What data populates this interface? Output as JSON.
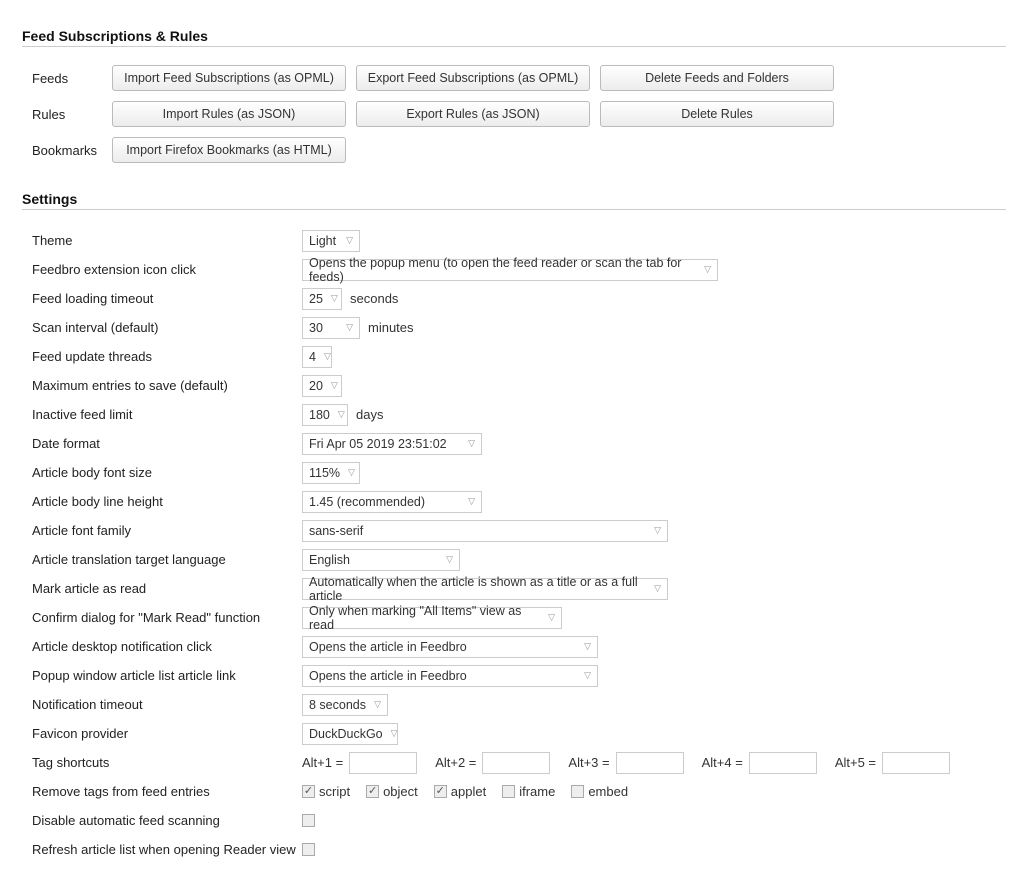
{
  "sections": {
    "subs_title": "Feed Subscriptions & Rules",
    "settings_title": "Settings"
  },
  "subs": {
    "feeds": {
      "label": "Feeds",
      "import": "Import Feed Subscriptions (as OPML)",
      "export": "Export Feed Subscriptions (as OPML)",
      "delete": "Delete Feeds and Folders"
    },
    "rules": {
      "label": "Rules",
      "import": "Import Rules (as JSON)",
      "export": "Export Rules (as JSON)",
      "delete": "Delete Rules"
    },
    "bookmarks": {
      "label": "Bookmarks",
      "import": "Import Firefox Bookmarks (as HTML)"
    }
  },
  "settings": {
    "theme": {
      "label": "Theme",
      "value": "Light"
    },
    "icon_click": {
      "label": "Feedbro extension icon click",
      "value": "Opens the popup menu (to open the feed reader or scan the tab for feeds)"
    },
    "load_timeout": {
      "label": "Feed loading timeout",
      "value": "25",
      "unit": "seconds"
    },
    "scan_interval": {
      "label": "Scan interval (default)",
      "value": "30",
      "unit": "minutes"
    },
    "update_threads": {
      "label": "Feed update threads",
      "value": "4"
    },
    "max_entries": {
      "label": "Maximum entries to save (default)",
      "value": "20"
    },
    "inactive_limit": {
      "label": "Inactive feed limit",
      "value": "180",
      "unit": "days"
    },
    "date_format": {
      "label": "Date format",
      "value": "Fri Apr 05 2019 23:51:02"
    },
    "body_font_size": {
      "label": "Article body font size",
      "value": "115%"
    },
    "body_line_height": {
      "label": "Article body line height",
      "value": "1.45 (recommended)"
    },
    "font_family": {
      "label": "Article font family",
      "value": "sans-serif"
    },
    "trans_lang": {
      "label": "Article translation target language",
      "value": "English"
    },
    "mark_read": {
      "label": "Mark article as read",
      "value": "Automatically when the article is shown as a title or as a full article"
    },
    "confirm_markread": {
      "label": "Confirm dialog for \"Mark Read\" function",
      "value": "Only when marking \"All Items\" view as read"
    },
    "desktop_notif_click": {
      "label": "Article desktop notification click",
      "value": "Opens the article in Feedbro"
    },
    "popup_article_link": {
      "label": "Popup window article list article link",
      "value": "Opens the article in Feedbro"
    },
    "notif_timeout": {
      "label": "Notification timeout",
      "value": "8 seconds"
    },
    "favicon_provider": {
      "label": "Favicon provider",
      "value": "DuckDuckGo"
    },
    "tag_shortcuts": {
      "label": "Tag shortcuts",
      "items": [
        {
          "prefix": "Alt+1 =",
          "value": ""
        },
        {
          "prefix": "Alt+2 =",
          "value": ""
        },
        {
          "prefix": "Alt+3 =",
          "value": ""
        },
        {
          "prefix": "Alt+4 =",
          "value": ""
        },
        {
          "prefix": "Alt+5 =",
          "value": ""
        }
      ]
    },
    "remove_tags": {
      "label": "Remove tags from feed entries",
      "options": [
        {
          "name": "script",
          "checked": true
        },
        {
          "name": "object",
          "checked": true
        },
        {
          "name": "applet",
          "checked": true
        },
        {
          "name": "iframe",
          "checked": false
        },
        {
          "name": "embed",
          "checked": false
        }
      ]
    },
    "disable_scan": {
      "label": "Disable automatic feed scanning",
      "checked": false
    },
    "refresh_on_open": {
      "label": "Refresh article list when opening Reader view",
      "checked": false
    }
  }
}
